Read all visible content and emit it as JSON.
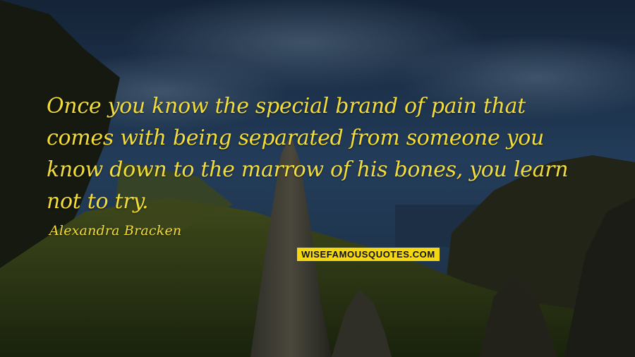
{
  "quote": {
    "lines": [
      "Once you know the special brand of pain that",
      "comes with being separated from someone you",
      "know down to the marrow of his bones, you learn",
      "not to try."
    ],
    "color": "#f2dc3c"
  },
  "author": "Alexandra Bracken",
  "watermark": {
    "text": "WISEFAMOUSQUOTES.COM",
    "background": "#f4d711"
  }
}
